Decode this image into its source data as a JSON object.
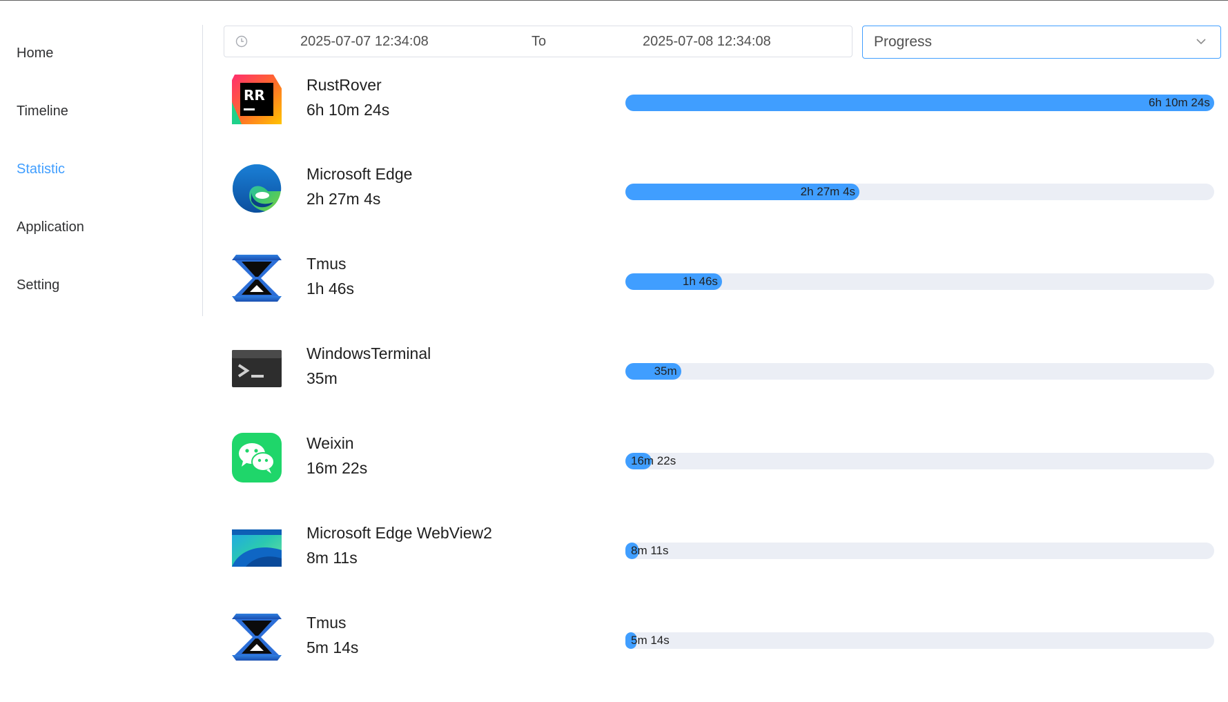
{
  "nav": [
    {
      "label": "Home",
      "active": false
    },
    {
      "label": "Timeline",
      "active": false
    },
    {
      "label": "Statistic",
      "active": true
    },
    {
      "label": "Application",
      "active": false
    },
    {
      "label": "Setting",
      "active": false
    }
  ],
  "filter": {
    "start": "2025-07-07 12:34:08",
    "separator": "To",
    "end": "2025-07-08 12:34:08",
    "view_mode": "Progress"
  },
  "apps": [
    {
      "name": "RustRover",
      "duration": "6h 10m 24s",
      "icon": "rustrover-icon",
      "progress": 1.0
    },
    {
      "name": "Microsoft Edge",
      "duration": "2h 27m 4s",
      "icon": "edge-icon",
      "progress": 0.397
    },
    {
      "name": "Tmus",
      "duration": "1h 46s",
      "icon": "tmus-icon",
      "progress": 0.164
    },
    {
      "name": "WindowsTerminal",
      "duration": "35m",
      "icon": "terminal-icon",
      "progress": 0.0945
    },
    {
      "name": "Weixin",
      "duration": "16m 22s",
      "icon": "weixin-icon",
      "progress": 0.0442
    },
    {
      "name": "Microsoft Edge WebView2",
      "duration": "8m 11s",
      "icon": "webview2-icon",
      "progress": 0.0221
    },
    {
      "name": "Tmus",
      "duration": "5m 14s",
      "icon": "tmus-icon",
      "progress": 0.0141
    }
  ],
  "colors": {
    "accent": "#409eff",
    "track": "#ebeef5"
  }
}
